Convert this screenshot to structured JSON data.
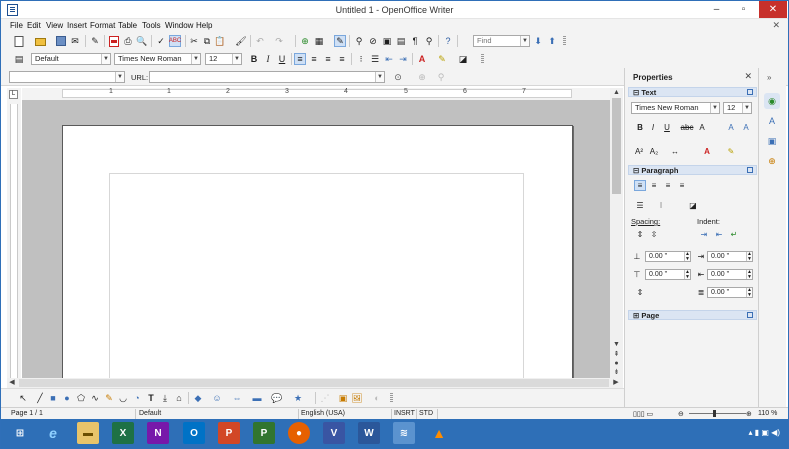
{
  "window": {
    "title": "Untitled 1 - OpenOffice Writer",
    "minimize_label": "–",
    "maximize_label": "▫",
    "close_label": "✕"
  },
  "menu": {
    "items": [
      "File",
      "Edit",
      "View",
      "Insert",
      "Format",
      "Table",
      "Tools",
      "Window",
      "Help"
    ],
    "doc_close": "✕"
  },
  "toolbar_standard": {
    "find_placeholder": "Find"
  },
  "toolbar_formatting": {
    "paragraph_style": "Default",
    "font_name": "Times New Roman",
    "font_size": "12",
    "bold": "B",
    "italic": "I",
    "underline": "U"
  },
  "toolbar_hyperlink": {
    "url_label": "URL:"
  },
  "ruler": {
    "numbers": [
      "1",
      "1",
      "2",
      "3",
      "4",
      "5",
      "6",
      "7"
    ]
  },
  "sidebar": {
    "title": "Properties",
    "close": "✕",
    "text_section": "Text",
    "font_name": "Times New Roman",
    "font_size": "12",
    "paragraph_section": "Paragraph",
    "spacing_label": "Spacing:",
    "indent_label": "Indent:",
    "above_spacing": "0.00 \"",
    "below_spacing": "0.00 \"",
    "before_indent": "0.00 \"",
    "after_indent": "0.00 \"",
    "first_line_indent": "0.00 \"",
    "page_section": "Page"
  },
  "statusbar": {
    "page": "Page 1 / 1",
    "style": "Default",
    "language": "English (USA)",
    "insert_mode": "INSRT",
    "selection_mode": "STD",
    "zoom": "110 %"
  },
  "colors": {
    "taskbar": "#2e6fb7",
    "close_button": "#c7302b",
    "selection": "#cfe0f5",
    "canvas": "#c0c0c0"
  }
}
